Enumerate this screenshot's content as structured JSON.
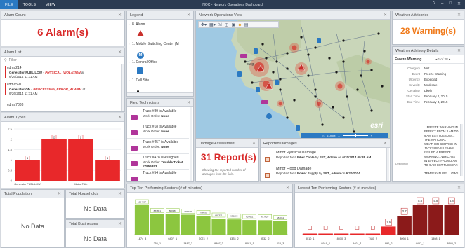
{
  "app": {
    "menu": [
      "FILE",
      "TOOLS",
      "VIEW"
    ],
    "title": "NOC - Network Operations Dashboard",
    "controls": [
      "?",
      "–",
      "□",
      "✕"
    ]
  },
  "alarm_count": {
    "title": "Alarm Count",
    "value": "6 Alarm(s)"
  },
  "alarm_list": {
    "title": "Alarm List",
    "filter_placeholder": "Filter",
    "items": [
      {
        "device": "cdma214",
        "event": "Generator FUEL LOW - ",
        "type": "PHYSICAL_VIOLATION",
        "suffix": " at",
        "time": "6/26/2014 11:11 AM"
      },
      {
        "device": "cdma591",
        "event": "Generator ON - ",
        "type": "PROCESSING_ERROR_ALARM",
        "suffix": " at",
        "time": "6/26/2014 11:11 AM"
      },
      {
        "device": "cdma7888",
        "event": "",
        "type": "",
        "suffix": "",
        "time": ""
      }
    ]
  },
  "alarm_types": {
    "title": "Alarm Types"
  },
  "legend": {
    "title": "Legend",
    "items": [
      {
        "label": "8. Alarm",
        "color": "#c9302c",
        "icon": "warning-icon"
      },
      {
        "label": "1. Mobile Switching Center (M",
        "color": "#2b79c2",
        "icon": "switch-m-icon"
      },
      {
        "label": "1. Central Office",
        "color": "#2b79c2",
        "icon": "building-icon"
      },
      {
        "label": "1. Cell Site",
        "color": "#111111",
        "icon": "dot-icon"
      }
    ]
  },
  "field_technicians": {
    "title": "Field Technicians",
    "items": [
      {
        "name": "Truck #89 is Available",
        "order_label": "Work Order: ",
        "order": "None"
      },
      {
        "name": "Truck #18 is Available",
        "order_label": "Work Order: ",
        "order": "None"
      },
      {
        "name": "Truck #457 is Available",
        "order_label": "Work Order: ",
        "order": "None"
      },
      {
        "name": "Truck #478 is Assigned",
        "order_label": "Work Order: ",
        "order": "Trouble Ticket #7856353"
      },
      {
        "name": "Truck #54 is Available",
        "order_label": "",
        "order": ""
      }
    ]
  },
  "map": {
    "title": "Network Operations View",
    "city": "burg",
    "zoom_label": "ZOOM",
    "watermark": "esri"
  },
  "damage_assessment": {
    "title": "Damage Assessment",
    "value": "31 Report(s)",
    "caption": "Showing the reported number of damages from the field."
  },
  "reported_damages": {
    "title": "Reported Damages",
    "items": [
      {
        "title": "Minor Pyhsical Damage",
        "pre": "Reported for a ",
        "asset": "Fiber Cable",
        "mid": " by ",
        "who": "SFT_Admin",
        "post": " on ",
        "date": "6/20/2014 09:38 AM."
      },
      {
        "title": "Minor Flood Damage",
        "pre": "Reported for a ",
        "asset": "Power Supply",
        "mid": " by ",
        "who": "SFT_Admin",
        "post": " on ",
        "date": "6/20/2014"
      }
    ]
  },
  "weather_advisories": {
    "title": "Weather Advisories",
    "value": "28 Warning(s)"
  },
  "weather_details": {
    "title": "Weather Advisory Details",
    "header": "Freeze Warning",
    "pager": "1 of 28",
    "fields": [
      {
        "k": "Category",
        "v": "Met"
      },
      {
        "k": "Event",
        "v": "Freeze Warning"
      },
      {
        "k": "Urgency",
        "v": "Expected"
      },
      {
        "k": "Severity",
        "v": "Moderate"
      },
      {
        "k": "Certainty",
        "v": "Likely"
      },
      {
        "k": "Start Time",
        "v": "February 2, 2015"
      },
      {
        "k": "End Time",
        "v": "February 3, 2015"
      }
    ],
    "description_label": "Description",
    "description_lines": [
      "...FREEZE WARNING IN",
      "EFFECT FROM 3 AM TO",
      "9 AM EST TUESDAY...",
      "THE NATIONAL",
      "WEATHER SERVICE IN",
      "JACKSONVILLE HAS",
      "ISSUED A FREEZE",
      "WARNING...WHICH IS",
      "IN EFFECT FROM 3 AM",
      "TO 9 AM EST TUESDAY.",
      "",
      "TEMPERATURE...LOWS"
    ]
  },
  "total_population": {
    "title": "Total Population",
    "value": "No Data"
  },
  "total_households": {
    "title": "Total Households",
    "value": "No Data"
  },
  "total_businesses": {
    "title": "Total Businesses",
    "value": "No Data"
  },
  "top_sectors": {
    "title": "Top Ten Performing Sectors (# of minutes)"
  },
  "low_sectors": {
    "title": "Lowest Ten Performing Sectors (# of minutes)"
  },
  "colors": {
    "accent": "#2b79c2",
    "alarm": "#d92b2b",
    "warning": "#f07a1a",
    "bar_red": "#e8282a",
    "bar_green": "#8cc63f",
    "bar_darkred": "#8b1a1a"
  },
  "chart_data": [
    {
      "type": "bar",
      "title": "Alarm Types",
      "categories": [
        "Generator FUEL LOW",
        "Generator ON",
        "Mains FAIL",
        "RectifierFAIL"
      ],
      "values": [
        1,
        2,
        2,
        1
      ],
      "ylim": [
        0,
        2.5
      ],
      "yticks": [
        "0",
        "0.5",
        "1",
        "1.5",
        "2",
        "2.5"
      ],
      "grid": true
    },
    {
      "type": "bar",
      "title": "Top Ten Performing Sectors (# of minutes)",
      "categories": [
        "1874_3",
        "256_1",
        "6407_1",
        "1487_3",
        "2074_2",
        "9407_3",
        "5378_2",
        "8081_1",
        "9532_2",
        "216_3"
      ],
      "values": [
        1254987,
        881651,
        880983,
        851978,
        796451,
        687321,
        651280,
        624611,
        617624,
        583051
      ],
      "value_labels": [
        "1254987",
        "881651",
        "880983",
        "851978",
        "796451",
        "687321",
        "651280",
        "624611",
        "617624",
        "583051"
      ]
    },
    {
      "type": "bar",
      "title": "Lowest Ten Performing Sectors (# of minutes)",
      "categories": [
        "8010_1",
        "8919_2",
        "8010_3",
        "5401_1",
        "7440_2",
        "890_2",
        "8098_1",
        "4457_1",
        "1808_1",
        "8940_2"
      ],
      "values": [
        0,
        0,
        0,
        0,
        0,
        1.6,
        3.7,
        5.8,
        5.8,
        5.8
      ],
      "value_labels": [
        "0",
        "0",
        "0",
        "0",
        "0",
        "1.6",
        "3.7",
        "5.8",
        "5.8",
        "5.8"
      ]
    }
  ]
}
